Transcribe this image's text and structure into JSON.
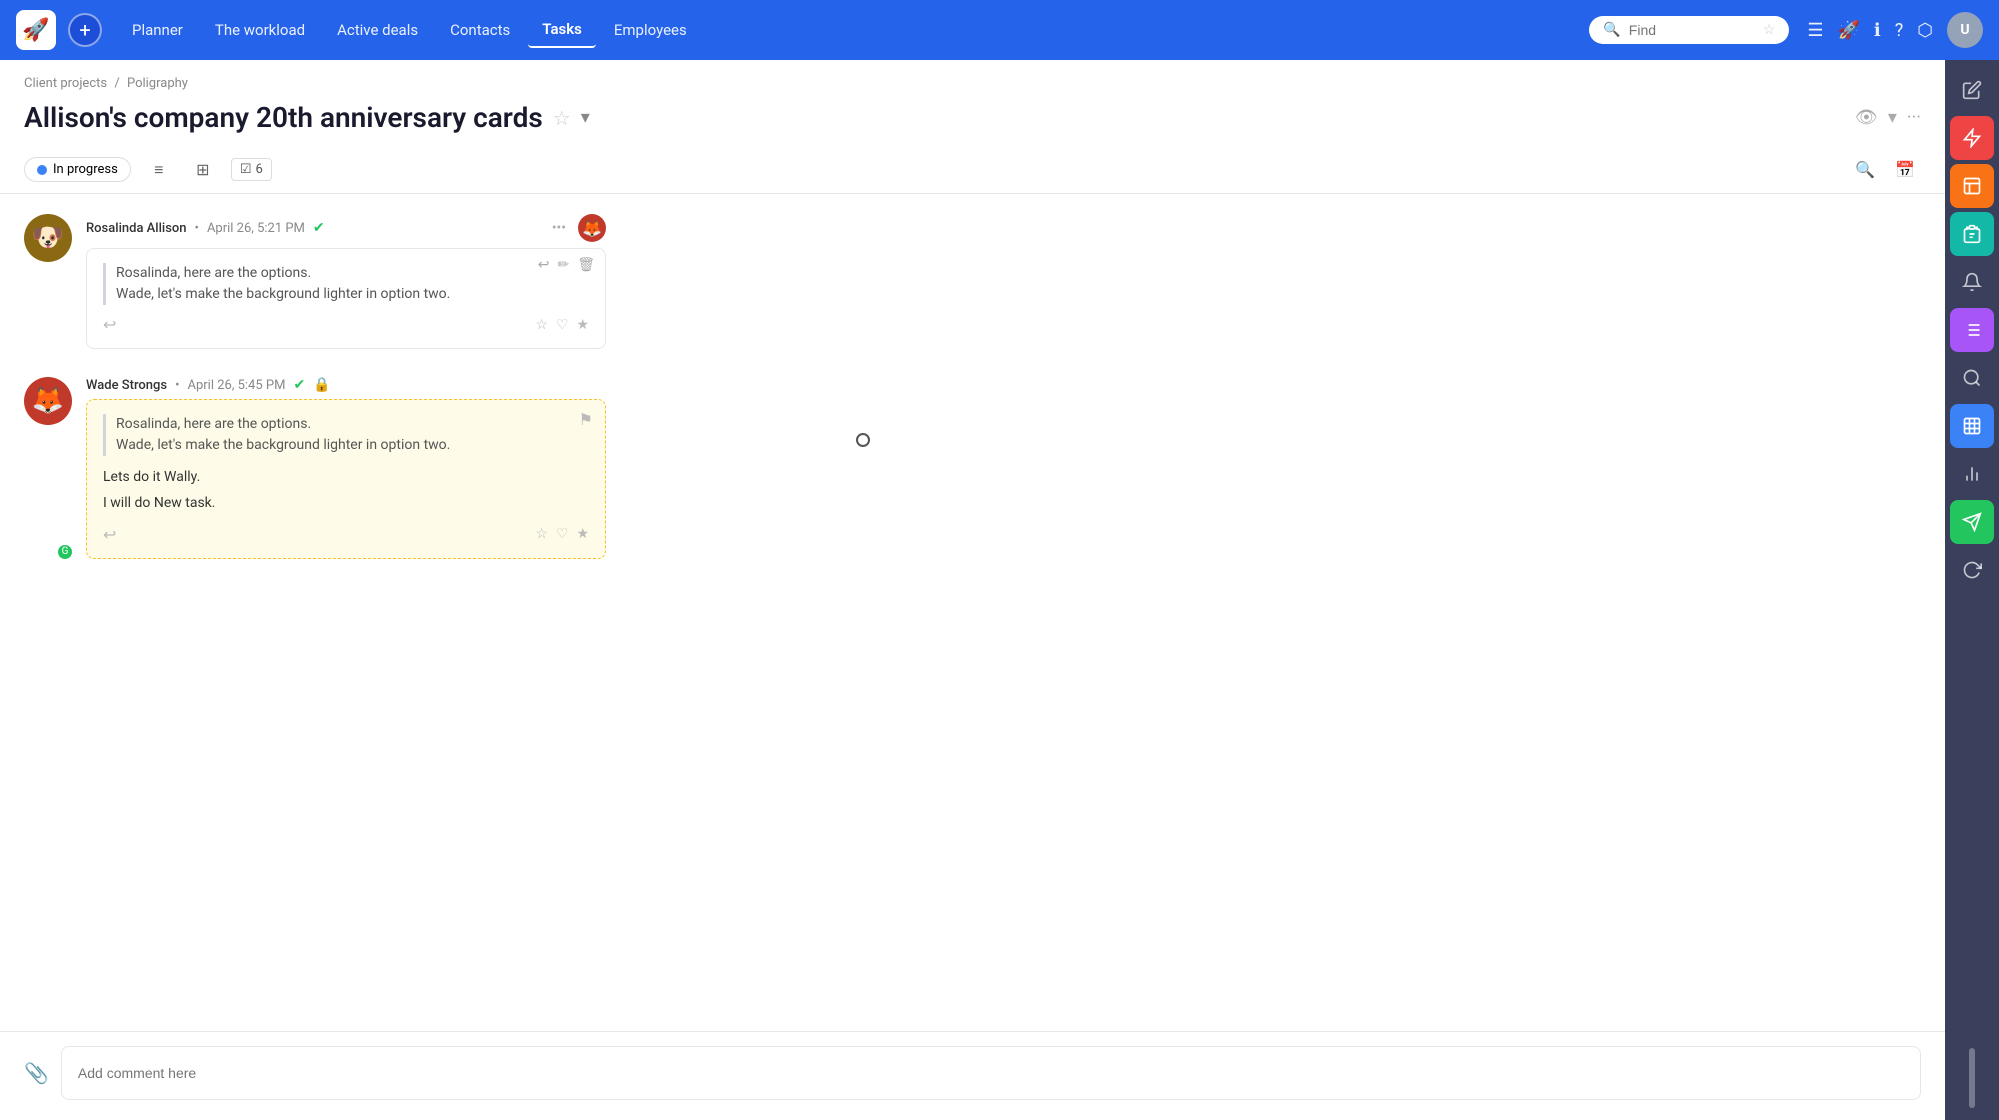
{
  "nav": {
    "logo": "🚀",
    "add_label": "+",
    "items": [
      {
        "id": "planner",
        "label": "Planner",
        "active": false
      },
      {
        "id": "workload",
        "label": "The workload",
        "active": false
      },
      {
        "id": "deals",
        "label": "Active deals",
        "active": false
      },
      {
        "id": "contacts",
        "label": "Contacts",
        "active": false
      },
      {
        "id": "tasks",
        "label": "Tasks",
        "active": true
      },
      {
        "id": "employees",
        "label": "Employees",
        "active": false
      }
    ],
    "search_placeholder": "Find",
    "icons": [
      "☰",
      "🔔",
      "ℹ",
      "?",
      "⬡"
    ],
    "star_icon": "☆"
  },
  "breadcrumb": {
    "parent": "Client projects",
    "separator": "/",
    "child": "Poligraphy"
  },
  "page": {
    "title": "Allison's company 20th anniversary cards",
    "star": "☆",
    "dropdown": "▾",
    "view_icon": "👁",
    "more_icon": "···"
  },
  "status_bar": {
    "status_label": "In progress",
    "tasks_count": "6",
    "search_icon": "🔍",
    "calendar_icon": "📅"
  },
  "comments": [
    {
      "id": "comment1",
      "author": "Rosalinda Allison",
      "timestamp": "April 26, 5:21 PM",
      "verified": true,
      "avatar_emoji": "🐶",
      "avatar_bg": "#4a3728",
      "reply_avatar_emoji": "🦊",
      "reply_avatar_bg": "#c0392b",
      "card_style": "normal",
      "quote": {
        "line1": "Rosalinda, here are the options.",
        "line2": "Wade, let's make the background lighter in option two."
      },
      "text_lines": [],
      "actions_top": [
        "↩",
        "✏",
        "🗑"
      ],
      "reactions": [
        "☆",
        "♡",
        "★"
      ]
    },
    {
      "id": "comment2",
      "author": "Wade Strongs",
      "timestamp": "April 26, 5:45 PM",
      "verified": true,
      "lock": true,
      "avatar_emoji": "🦊",
      "avatar_bg": "#c0392b",
      "avatar_badge": "G",
      "card_style": "reply",
      "quote": {
        "line1": "Rosalinda, here are the options.",
        "line2": "Wade, let's make the background lighter in option two."
      },
      "text_lines": [
        "Lets do it Wally.",
        "I will do New task."
      ],
      "flag_icon": "⚑",
      "reactions": [
        "☆",
        "♡",
        "★"
      ]
    }
  ],
  "comment_input": {
    "placeholder": "Add comment here",
    "attach_icon": "📎"
  },
  "right_sidebar": {
    "icons": [
      {
        "id": "edit",
        "symbol": "✏",
        "color": "default"
      },
      {
        "id": "alert",
        "symbol": "⚡",
        "color": "red"
      },
      {
        "id": "chart",
        "symbol": "⊞",
        "color": "orange"
      },
      {
        "id": "clipboard",
        "symbol": "📋",
        "color": "teal"
      },
      {
        "id": "bell",
        "symbol": "🔔",
        "color": "default"
      },
      {
        "id": "list",
        "symbol": "☰",
        "color": "purple"
      },
      {
        "id": "search",
        "symbol": "🔍",
        "color": "default"
      },
      {
        "id": "table",
        "symbol": "⊡",
        "color": "blue"
      },
      {
        "id": "bar-chart",
        "symbol": "📊",
        "color": "default"
      },
      {
        "id": "send",
        "symbol": "➤",
        "color": "green"
      },
      {
        "id": "sync",
        "symbol": "↻",
        "color": "default"
      }
    ]
  }
}
